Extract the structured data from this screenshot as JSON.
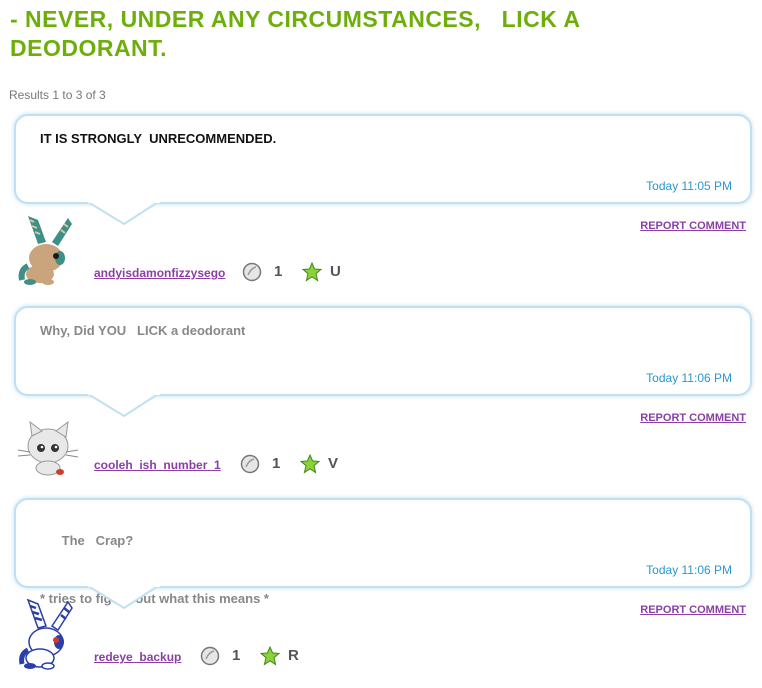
{
  "page_title": "- NEVER, UNDER ANY CIRCUMSTANCES,   LICK A DEODORANT.",
  "results_text": "Results 1 to 3 of 3",
  "report_label": "REPORT COMMENT",
  "colors": {
    "title": "#6dae0b",
    "link": "#8b3fa6",
    "time": "#2a97cf",
    "bubble_border": "#bfe0f2"
  },
  "icons": {
    "coin": "coin-icon",
    "star": "green-star-icon"
  },
  "comments": [
    {
      "text": "IT IS STRONGLY  UNRECOMMENDED.",
      "text_line2": "",
      "time": "Today 11:05 PM",
      "username": "andyisdamonfizzysego",
      "coin_count": "1",
      "star_letter": "U",
      "avatar": "brown-bunny-avatar"
    },
    {
      "text": "Why, Did YOU   LICK a deodorant",
      "text_line2": "",
      "time": "Today 11:06 PM",
      "username": "cooleh_ish_number_1",
      "coin_count": "1",
      "star_letter": "V",
      "avatar": "grey-kitten-avatar"
    },
    {
      "text": "The   Crap?",
      "text_line2": "* tries to figure out what this means *",
      "time": "Today 11:06 PM",
      "username": "redeye_backup",
      "coin_count": "1",
      "star_letter": "R",
      "avatar": "blue-white-bunny-avatar"
    }
  ]
}
